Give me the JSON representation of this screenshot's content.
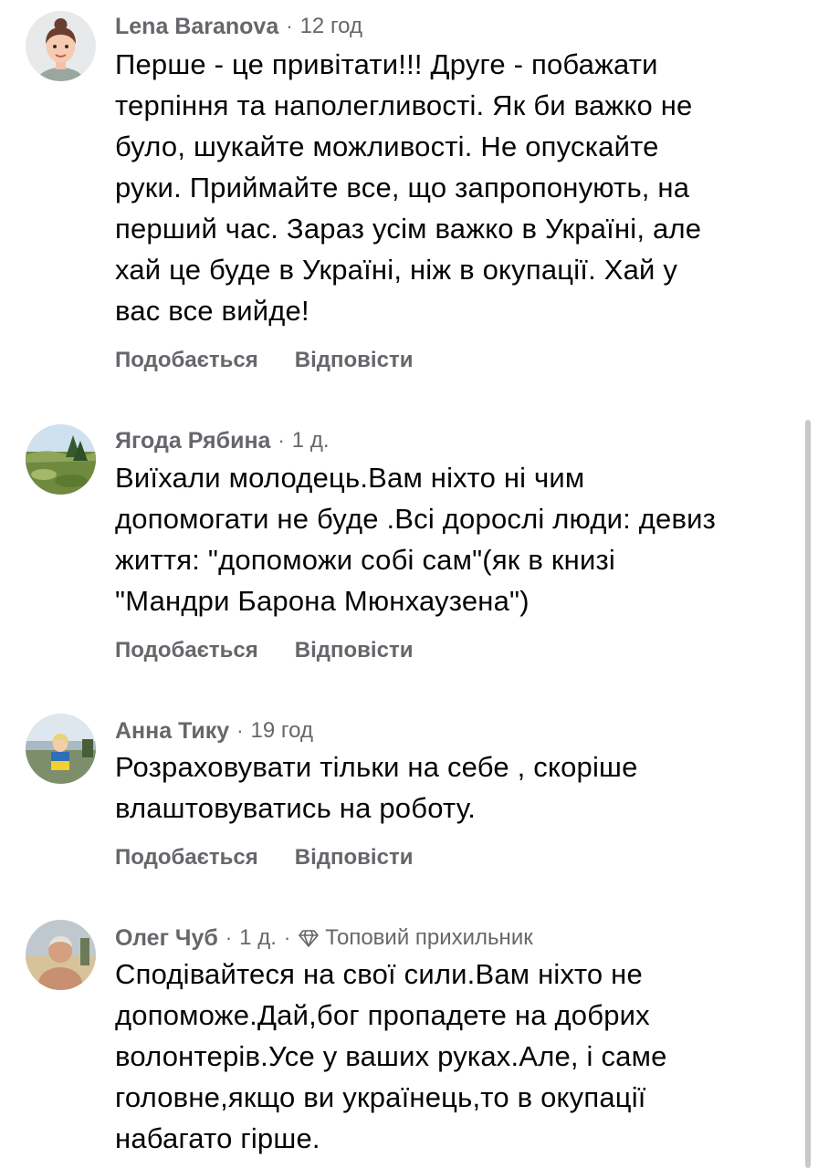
{
  "comments": [
    {
      "author": "Lena Baranova",
      "time": "12 год",
      "badge": "",
      "lines": [
        "Перше - це привітати!!! Друге - побажати",
        "терпіння та наполегливості. Як би важко не",
        "було, шукайте можливості. Не опускайте",
        "руки. Приймайте все, що запропонують, на",
        "перший час. Зараз усім важко в Україні, але",
        "хай це буде в Україні, ніж в окупації. Хай у",
        "вас все вийде!"
      ],
      "like_label": "Подобається",
      "reply_label": "Відповісти",
      "avatar_icon": "cartoon-avatar-icon"
    },
    {
      "author": "Ягода Рябина",
      "time": "1 д.",
      "badge": "",
      "lines": [
        "Виїхали молодець.Вам ніхто ні чим",
        "допомогати не буде .Всі дорослі люди: девиз",
        "життя: \"допоможи собі сам\"(як в книзі",
        "\"Мандри Барона Мюнхаузена\")"
      ],
      "like_label": "Подобається",
      "reply_label": "Відповісти",
      "avatar_icon": "landscape-photo"
    },
    {
      "author": "Анна Тику",
      "time": "19 год",
      "badge": "",
      "lines": [
        "Розраховувати тільки на себе , скоріше",
        "влаштовуватись на роботу."
      ],
      "like_label": "Подобається",
      "reply_label": "Відповісти",
      "avatar_icon": "person-with-flag-photo"
    },
    {
      "author": "Олег Чуб",
      "time": "1 д.",
      "badge": "Топовий прихильник",
      "lines": [
        "Сподівайтеся на свої сили.Вам ніхто не",
        "допоможе.Дай,бог пропадете на добрих",
        "волонтерів.Усе у ваших руках.Але, і саме",
        "головне,якщо ви українець,то в окупації",
        "набагато гірше."
      ],
      "like_label": "",
      "reply_label": "",
      "avatar_icon": "person-beach-photo"
    }
  ],
  "separator": "·",
  "badge_icon": "diamond-icon",
  "colors": {
    "meta": "#65676b",
    "text": "#050505",
    "scrollbar": "#c7c8cc"
  }
}
